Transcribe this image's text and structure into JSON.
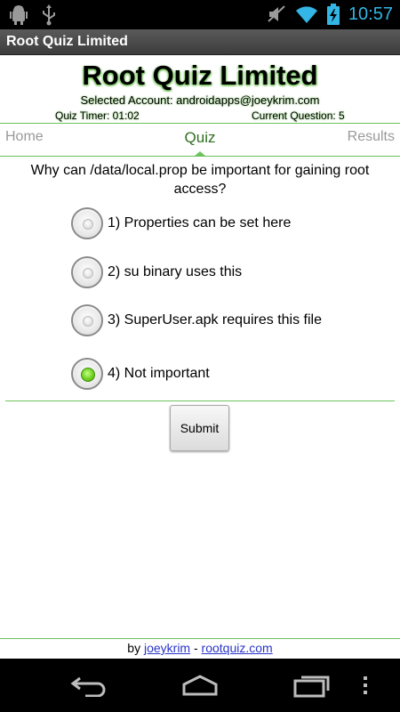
{
  "status_bar": {
    "time": "10:57",
    "left_icons": [
      "android-debug-icon",
      "usb-icon"
    ],
    "right_icons": [
      "muted-icon",
      "wifi-icon",
      "battery-charging-icon"
    ]
  },
  "title_bar": {
    "title": "Root Quiz Limited"
  },
  "header": {
    "heading": "Root Quiz Limited",
    "account": "Selected Account: androidapps@joeykrim.com",
    "timer": "Quiz Timer: 01:02",
    "current_question": "Current Question: 5"
  },
  "tabs": {
    "home": "Home",
    "quiz": "Quiz",
    "results": "Results"
  },
  "quiz": {
    "question": "Why can /data/local.prop be important for gaining root access?",
    "options": [
      {
        "label": "1) Properties can be set here",
        "checked": false
      },
      {
        "label": "2) su binary uses this",
        "checked": false
      },
      {
        "label": "3) SuperUser.apk requires this file",
        "checked": false
      },
      {
        "label": "4) Not important",
        "checked": true
      }
    ],
    "submit_label": "Submit"
  },
  "footer": {
    "by": "by",
    "author": "joeykrim",
    "separator": "-",
    "site": "rootquiz.com"
  },
  "colors": {
    "accent": "#6bc25a",
    "link": "#2a35c8",
    "time": "#33b5e5"
  },
  "nav_bar": {
    "icons": [
      "back-icon",
      "home-icon",
      "recent-apps-icon",
      "menu-icon"
    ]
  }
}
